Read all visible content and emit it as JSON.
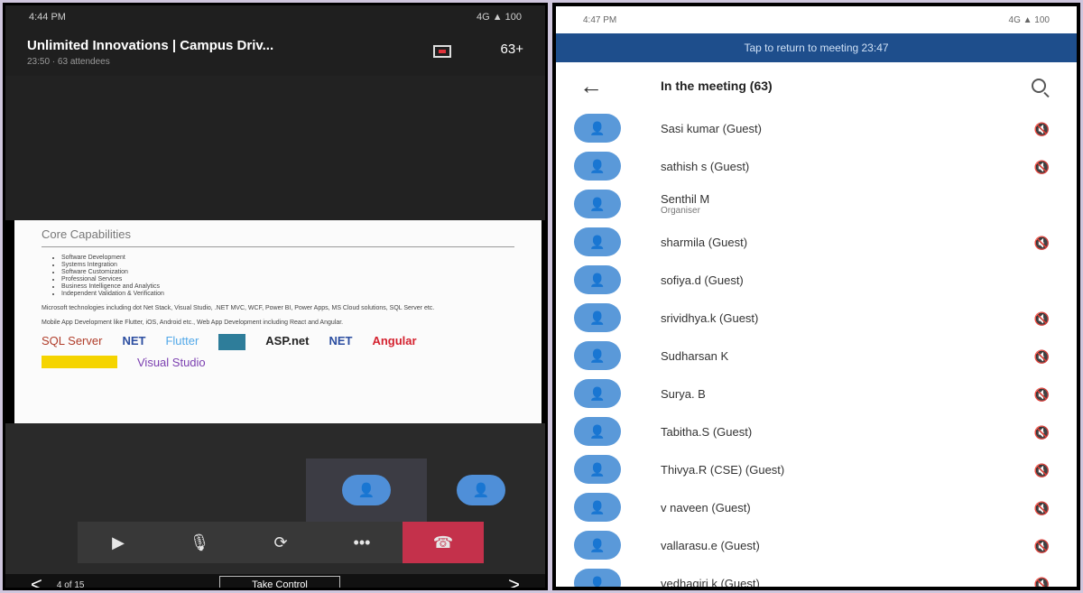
{
  "left": {
    "status_time": "4:44 PM",
    "status_right": "4G ▲ 100",
    "meeting_title": "Unlimited Innovations | Campus Driv...",
    "meeting_sub": "23:50 · 63 attendees",
    "people_count": "63+",
    "slide": {
      "title": "Core Capabilities",
      "bullets": [
        "Software Development",
        "Systems Integration",
        "Software Customization",
        "Professional Services",
        "Business Intelligence and Analytics",
        "Independent Validation & Verification"
      ],
      "para1": "Microsoft technologies including dot Net Stack, Visual Studio, .NET MVC, WCF, Power BI, Power Apps, MS Cloud solutions, SQL Server etc.",
      "para2": "Mobile App Development like Flutter, iOS, Android etc., Web App Development including React and Angular.",
      "logos": [
        "SQL Server",
        "NET",
        "Flutter",
        "ASP.net",
        "NET",
        "Angular",
        "Visual Studio"
      ]
    },
    "controls": {
      "video": "▶",
      "mic": "🎙",
      "share": "⟳",
      "more": "•••",
      "hangup": "☎"
    },
    "page_indicator": "4 of 15",
    "take_control": "Take Control"
  },
  "right": {
    "status_time": "4:47 PM",
    "status_right": "4G ▲ 100",
    "banner": "Tap to return to meeting 23:47",
    "title": "In the meeting (63)",
    "people": [
      {
        "name": "Sasi kumar (Guest)",
        "role": "",
        "muted": true
      },
      {
        "name": "sathish s (Guest)",
        "role": "",
        "muted": true
      },
      {
        "name": "Senthil M",
        "role": "Organiser",
        "muted": false
      },
      {
        "name": "sharmila (Guest)",
        "role": "",
        "muted": true
      },
      {
        "name": "sofiya.d (Guest)",
        "role": "",
        "muted": false
      },
      {
        "name": "srividhya.k (Guest)",
        "role": "",
        "muted": true
      },
      {
        "name": "Sudharsan K",
        "role": "",
        "muted": true
      },
      {
        "name": "Surya. B",
        "role": "",
        "muted": true
      },
      {
        "name": "Tabitha.S (Guest)",
        "role": "",
        "muted": true
      },
      {
        "name": "Thivya.R (CSE) (Guest)",
        "role": "",
        "muted": true
      },
      {
        "name": "v naveen (Guest)",
        "role": "",
        "muted": true
      },
      {
        "name": "vallarasu.e (Guest)",
        "role": "",
        "muted": true
      },
      {
        "name": "vedhagiri k (Guest)",
        "role": "",
        "muted": true
      }
    ]
  },
  "colors": {
    "accent": "#4f8fd8",
    "banner": "#1e4e8c",
    "hangup": "#c4314b",
    "frame_bg": "#cfc6dd"
  }
}
